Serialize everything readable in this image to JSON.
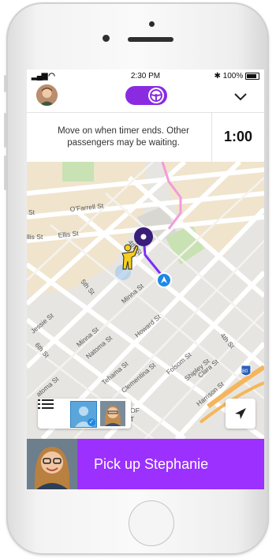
{
  "status_bar": {
    "time": "2:30 PM",
    "battery": "100%"
  },
  "notice": {
    "message": "Move on when timer ends. Other passengers may be waiting.",
    "timer": "1:00"
  },
  "map": {
    "streets": [
      "St",
      "O'Farrell St",
      "llis St",
      "Ellis St",
      "4th St",
      "5th St",
      "Minna St",
      "Jessie St",
      "Minna St",
      "Natoma St",
      "Howard St",
      "6th St",
      "Tehama St",
      "Clementina St",
      "Folsom St",
      "Shipley St",
      "Clara St",
      "4th St",
      "Harrison St",
      "atoma St",
      "OF",
      "T",
      "80"
    ]
  },
  "action": {
    "label": "Pick up Stephanie"
  },
  "colors": {
    "accent": "#9b30ff",
    "route": "#7b2ff7",
    "location": "#1e88e5"
  }
}
